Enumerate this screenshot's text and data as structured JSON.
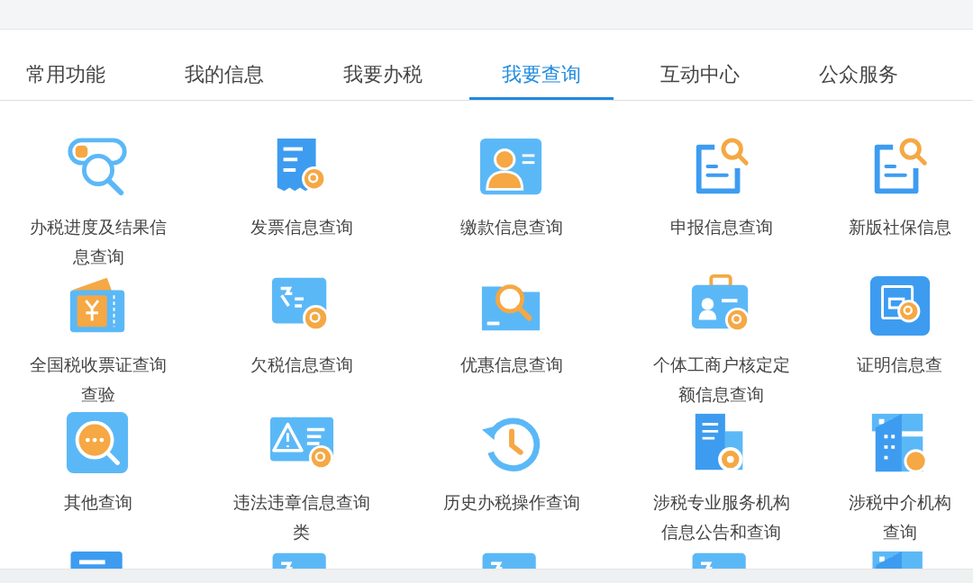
{
  "tabs": [
    {
      "label": "常用功能",
      "selected": false
    },
    {
      "label": "我的信息",
      "selected": false
    },
    {
      "label": "我要办税",
      "selected": false
    },
    {
      "label": "我要查询",
      "selected": true
    },
    {
      "label": "互动中心",
      "selected": false
    },
    {
      "label": "公众服务",
      "selected": false
    }
  ],
  "items": [
    {
      "kind": "toggle-search",
      "lines": [
        "办税进度及结果信",
        "息查询"
      ]
    },
    {
      "kind": "receipt",
      "lines": [
        "发票信息查询"
      ]
    },
    {
      "kind": "id-card",
      "lines": [
        "缴款信息查询"
      ]
    },
    {
      "kind": "doc-search",
      "lines": [
        "申报信息查询"
      ]
    },
    {
      "kind": "doc-search",
      "lines": [
        "新版社保信息"
      ]
    },
    {
      "kind": "ticket",
      "lines": [
        "全国税收票证查询",
        "查验"
      ]
    },
    {
      "kind": "card-search",
      "lines": [
        "欠税信息查询"
      ]
    },
    {
      "kind": "folder-search",
      "lines": [
        "优惠信息查询"
      ]
    },
    {
      "kind": "badge",
      "lines": [
        "个体工商户核定定",
        "额信息查询"
      ]
    },
    {
      "kind": "certificate",
      "lines": [
        "证明信息查"
      ]
    },
    {
      "kind": "chat-search",
      "lines": [
        "其他查询"
      ]
    },
    {
      "kind": "warning-card",
      "lines": [
        "违法违章信息查询",
        "类"
      ]
    },
    {
      "kind": "history",
      "lines": [
        "历史办税操作查询"
      ]
    },
    {
      "kind": "building-gear",
      "lines": [
        "涉税专业服务机构",
        "信息公告和查询"
      ]
    },
    {
      "kind": "building",
      "lines": [
        "涉税中介机构",
        "查询"
      ]
    },
    {
      "kind": "doc"
    },
    {
      "kind": "card-search"
    },
    {
      "kind": "card-search"
    },
    {
      "kind": "card-search"
    },
    {
      "kind": "building"
    }
  ]
}
